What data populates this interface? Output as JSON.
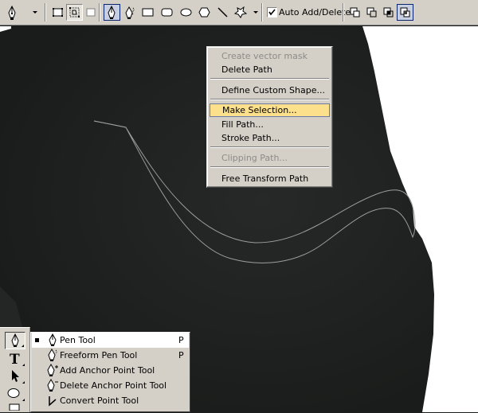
{
  "options_bar": {
    "auto_add_delete_label": "Auto Add/Delete",
    "auto_add_delete_checked": true
  },
  "context_menu": {
    "items": [
      {
        "label": "Create vector mask",
        "enabled": false
      },
      {
        "label": "Delete Path",
        "enabled": true
      },
      {
        "label": "Define Custom Shape...",
        "enabled": true
      },
      {
        "label": "Make Selection...",
        "enabled": true,
        "highlighted": true
      },
      {
        "label": "Fill Path...",
        "enabled": true
      },
      {
        "label": "Stroke Path...",
        "enabled": true
      },
      {
        "label": "Clipping Path...",
        "enabled": false
      },
      {
        "label": "Free Transform Path",
        "enabled": true
      }
    ]
  },
  "tool_flyout": {
    "items": [
      {
        "label": "Pen Tool",
        "shortcut": "P",
        "selected": true
      },
      {
        "label": "Freeform Pen Tool",
        "shortcut": "P"
      },
      {
        "label": "Add Anchor Point Tool",
        "shortcut": ""
      },
      {
        "label": "Delete Anchor Point Tool",
        "shortcut": ""
      },
      {
        "label": "Convert Point Tool",
        "shortcut": ""
      }
    ]
  },
  "colors": {
    "canvas_dark": "#1b1d1c",
    "chrome": "#d4d0c8",
    "menu_highlight": "#fde08c",
    "path_stroke": "#9a9e9c"
  }
}
